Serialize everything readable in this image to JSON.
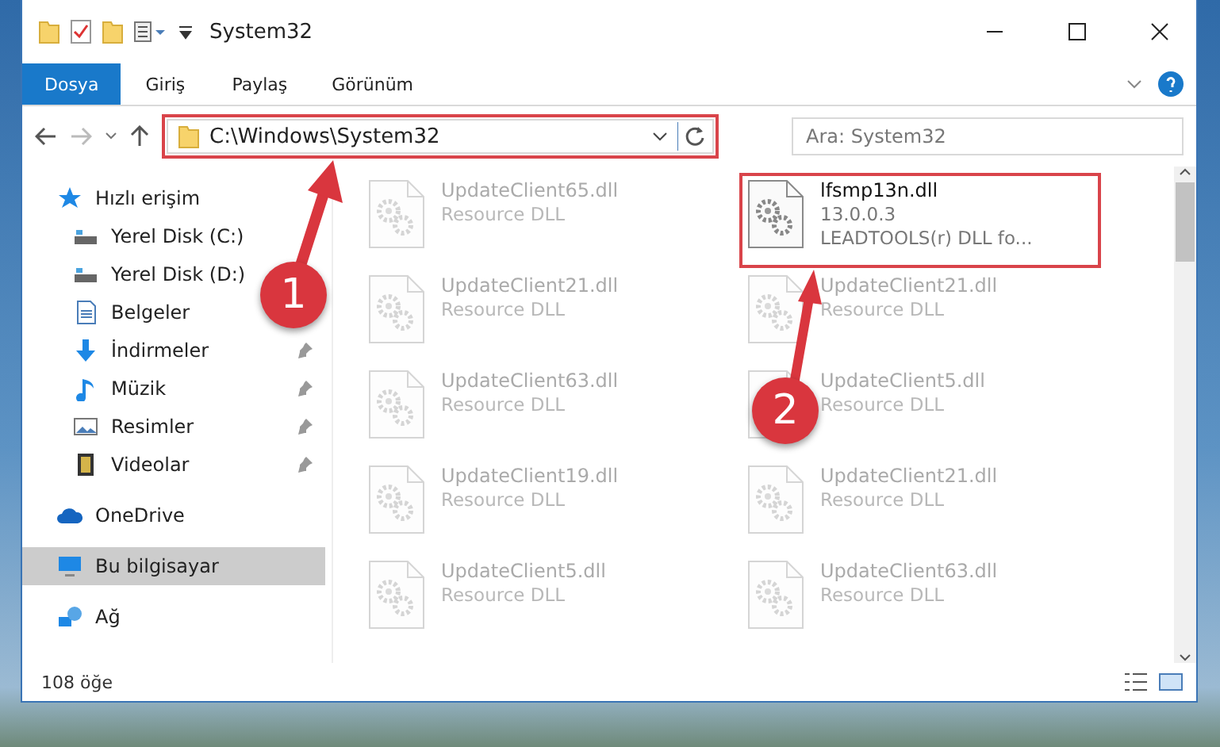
{
  "window": {
    "title": "System32"
  },
  "ribbon_tabs": [
    {
      "label": "Dosya",
      "selected": true
    },
    {
      "label": "Giriş",
      "selected": false
    },
    {
      "label": "Paylaş",
      "selected": false
    },
    {
      "label": "Görünüm",
      "selected": false
    }
  ],
  "address": {
    "path": "C:\\Windows\\System32"
  },
  "search": {
    "placeholder": "Ara: System32"
  },
  "sidebar": {
    "items": [
      {
        "label": "Hızlı erişim",
        "kind": "star",
        "selected": false,
        "children": [
          {
            "label": "Yerel Disk (C:)",
            "kind": "disk",
            "selected": false
          },
          {
            "label": "Yerel Disk (D:)",
            "kind": "disk",
            "selected": false
          },
          {
            "label": "Belgeler",
            "kind": "document",
            "selected": false
          },
          {
            "label": "İndirmeler",
            "kind": "download",
            "selected": false,
            "pinned": true
          },
          {
            "label": "Müzik",
            "kind": "music",
            "selected": false,
            "pinned": true
          },
          {
            "label": "Resimler",
            "kind": "picture",
            "selected": false,
            "pinned": true
          },
          {
            "label": "Videolar",
            "kind": "video",
            "selected": false,
            "pinned": true
          }
        ]
      },
      {
        "label": "OneDrive",
        "kind": "cloud",
        "selected": false
      },
      {
        "label": "Bu bilgisayar",
        "kind": "computer",
        "selected": true
      },
      {
        "label": "Ağ",
        "kind": "network",
        "selected": false
      }
    ]
  },
  "files": [
    {
      "name": "UpdateClient65.dll",
      "type": "Resource DLL",
      "dimmed": true
    },
    {
      "name": "lfsmp13n.dll",
      "type": "13.0.0.3",
      "description": "LEADTOOLS(r) DLL fo...",
      "dimmed": false
    },
    {
      "name": "UpdateClient21.dll",
      "type": "Resource DLL",
      "dimmed": true
    },
    {
      "name": "UpdateClient21.dll",
      "type": "Resource DLL",
      "dimmed": true
    },
    {
      "name": "UpdateClient63.dll",
      "type": "Resource DLL",
      "dimmed": true
    },
    {
      "name": "UpdateClient5.dll",
      "type": "Resource DLL",
      "dimmed": true
    },
    {
      "name": "UpdateClient19.dll",
      "type": "Resource DLL",
      "dimmed": true
    },
    {
      "name": "UpdateClient21.dll",
      "type": "Resource DLL",
      "dimmed": true
    },
    {
      "name": "UpdateClient5.dll",
      "type": "Resource DLL",
      "dimmed": true
    },
    {
      "name": "UpdateClient63.dll",
      "type": "Resource DLL",
      "dimmed": true
    }
  ],
  "status_bar": {
    "count": "108 öğe"
  },
  "annotations": [
    {
      "label": "1"
    },
    {
      "label": "2"
    }
  ]
}
